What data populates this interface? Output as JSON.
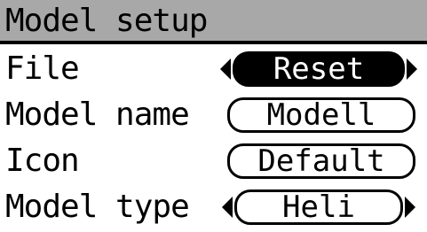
{
  "header": {
    "title": "Model setup"
  },
  "rows": [
    {
      "label": "File",
      "value": "Reset",
      "selected": true,
      "has_arrows": true
    },
    {
      "label": "Model name",
      "value": "Modell",
      "selected": false,
      "has_arrows": false
    },
    {
      "label": "Icon",
      "value": "Default",
      "selected": false,
      "has_arrows": false
    },
    {
      "label": "Model type",
      "value": "Heli",
      "selected": false,
      "has_arrows": true
    }
  ],
  "colors": {
    "title_bar": "#a8a8a8",
    "background": "#ffffff",
    "text": "#000000",
    "selected_fill": "#000000"
  },
  "icons": {
    "prev": "chevron-left-icon",
    "next": "chevron-right-icon"
  }
}
